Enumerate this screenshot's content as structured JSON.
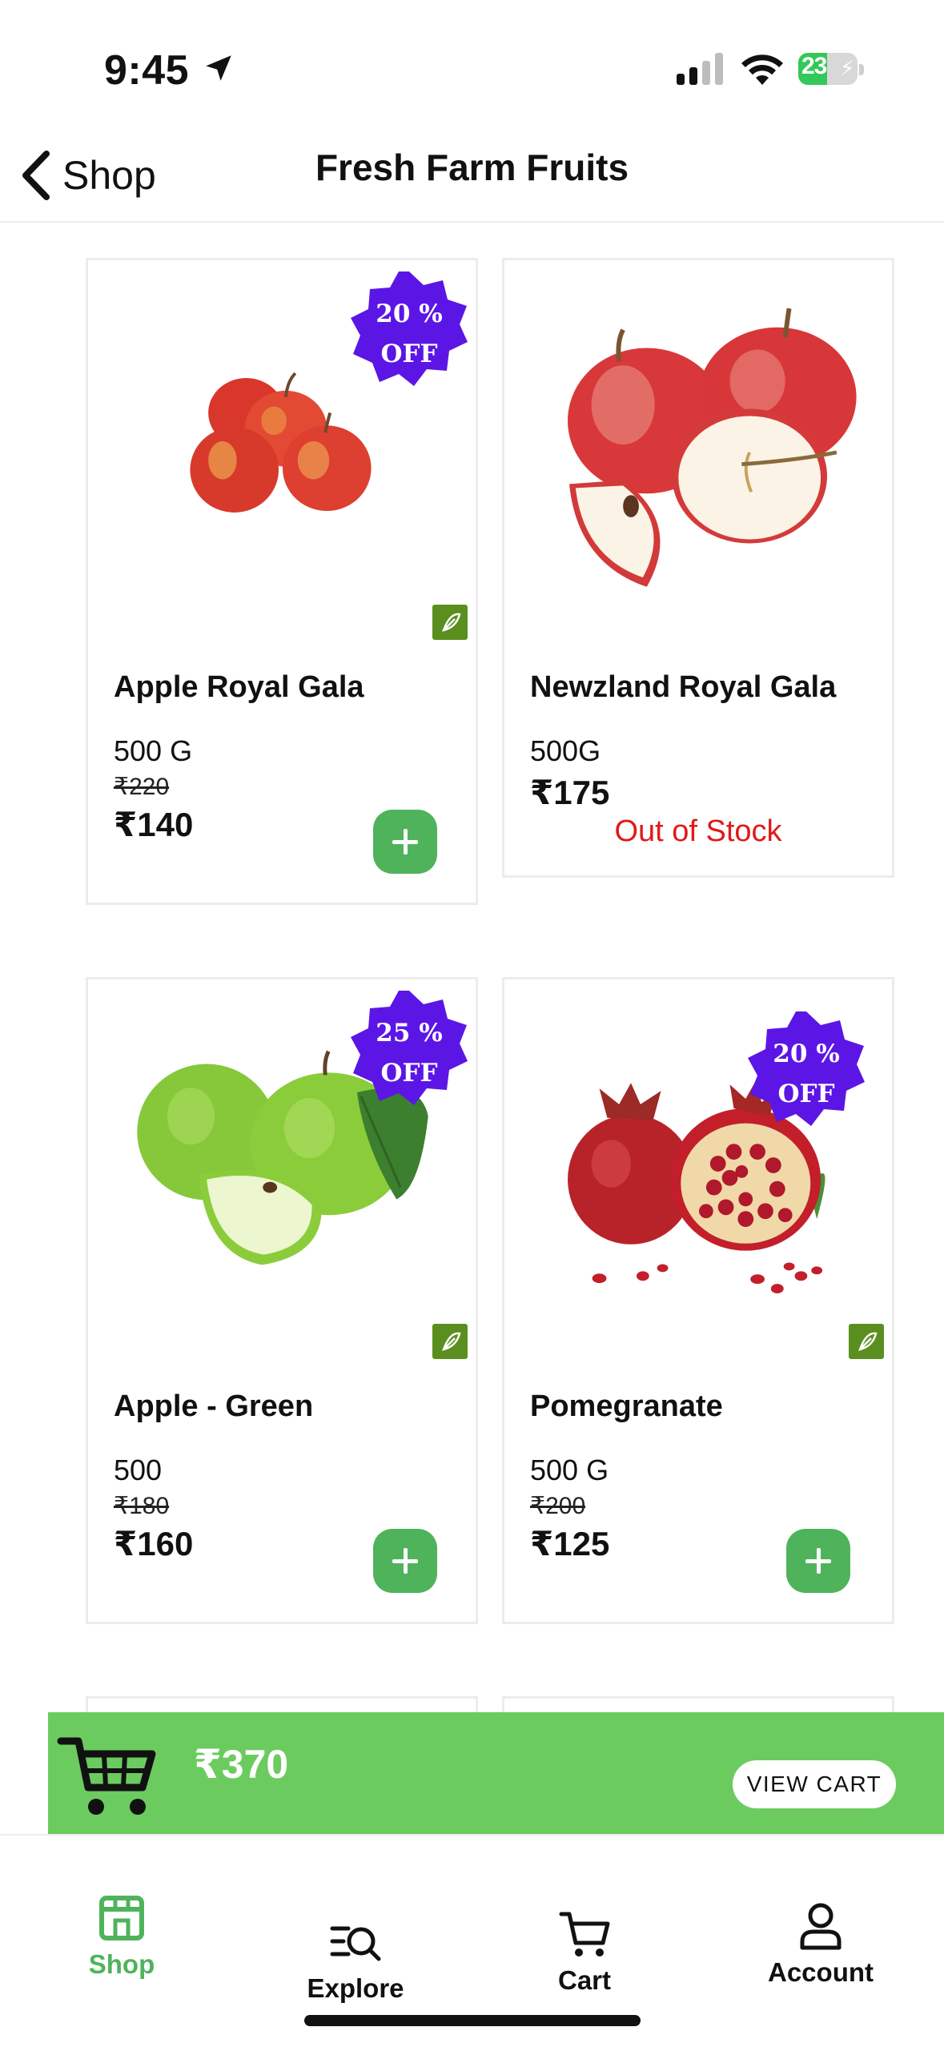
{
  "status_bar": {
    "time": "9:45",
    "battery": "23"
  },
  "nav": {
    "back_label": "Shop",
    "title": "Fresh Farm Fruits"
  },
  "products": [
    {
      "name": "Apple Royal Gala",
      "weight": "500 G",
      "mrp": "₹220",
      "price": "₹140",
      "discount_line1": "20 %",
      "discount_line2": "OFF",
      "veg_icon": "leaf-icon",
      "action": "add-button"
    },
    {
      "name": "Newzland Royal Gala",
      "weight": "500G",
      "price": "₹175",
      "stock_status": "Out of Stock"
    },
    {
      "name": "Apple - Green",
      "weight": "500",
      "mrp": "₹180",
      "price": "₹160",
      "discount_line1": "25 %",
      "discount_line2": "OFF",
      "veg_icon": "leaf-icon",
      "action": "add-button"
    },
    {
      "name": "Pomegranate",
      "weight": "500 G",
      "mrp": "₹200",
      "price": "₹125",
      "discount_line1": "20 %",
      "discount_line2": "OFF",
      "veg_icon": "leaf-icon",
      "action": "add-button"
    }
  ],
  "cart_bar": {
    "total": "₹370",
    "button_label": "VIEW CART"
  },
  "tabs": [
    {
      "label": "Shop",
      "icon": "store-icon",
      "active": true
    },
    {
      "label": "Explore",
      "icon": "search-list-icon",
      "active": false
    },
    {
      "label": "Cart",
      "icon": "cart-icon",
      "active": false
    },
    {
      "label": "Account",
      "icon": "user-icon",
      "active": false
    }
  ],
  "colors": {
    "accent_green": "#4fb35c",
    "cart_bar_green": "#6ccb5f",
    "discount_purple": "#5b16e6",
    "out_of_stock_red": "#e11919"
  }
}
